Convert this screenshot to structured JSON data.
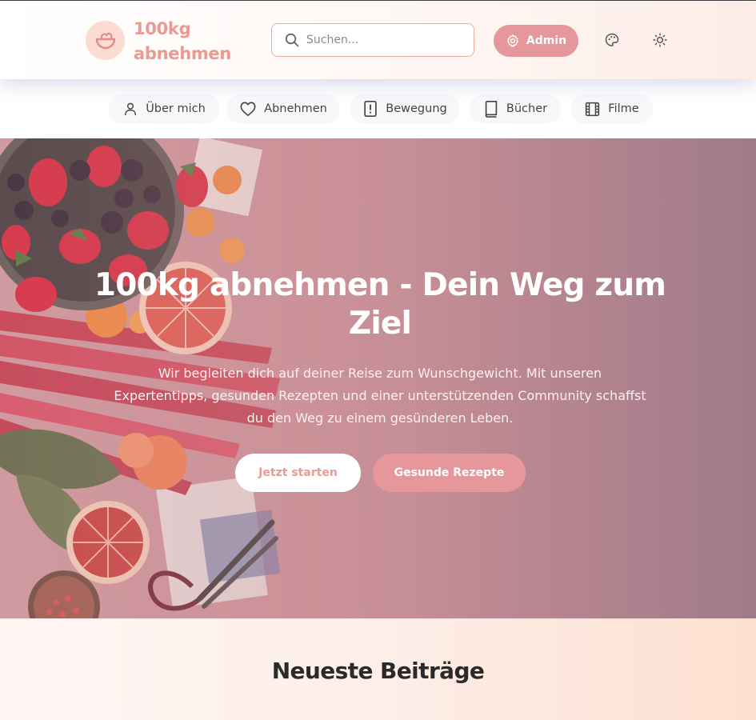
{
  "brand": {
    "name": "100kg abnehmen",
    "accent": "#e99a93"
  },
  "search": {
    "placeholder": "Suchen...",
    "icon": "search-icon"
  },
  "header": {
    "admin_label": "Admin",
    "admin_icon": "gear-icon",
    "theme_icon": "palette-icon",
    "mode_icon": "sun-icon"
  },
  "nav": {
    "items": [
      {
        "label": "Über mich",
        "icon": "user-icon"
      },
      {
        "label": "Abnehmen",
        "icon": "heart-icon"
      },
      {
        "label": "Bewegung",
        "icon": "alert-icon"
      },
      {
        "label": "Bücher",
        "icon": "book-icon"
      },
      {
        "label": "Filme",
        "icon": "film-icon"
      }
    ]
  },
  "hero": {
    "title": "100kg abnehmen - Dein Weg zum Ziel",
    "subtitle": "Wir begleiten dich auf deiner Reise zum Wunschgewicht. Mit unseren Expertentipps, gesunden Rezepten und einer unterstützenden Community schaffst du den Weg zu einem gesünderen Leben.",
    "primary_button": "Jetzt starten",
    "secondary_button": "Gesunde Rezepte"
  },
  "latest": {
    "heading": "Neueste Beiträge"
  }
}
